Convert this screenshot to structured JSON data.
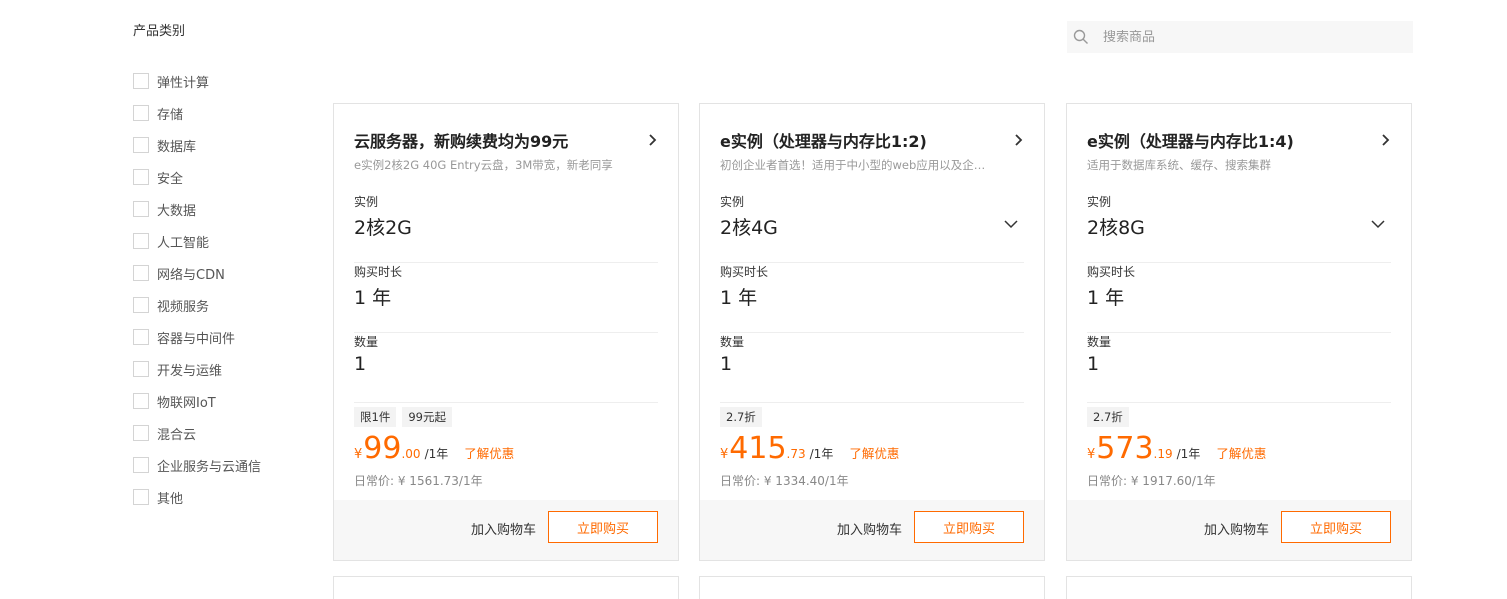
{
  "sidebar": {
    "title": "产品类别",
    "categories": [
      "弹性计算",
      "存储",
      "数据库",
      "安全",
      "大数据",
      "人工智能",
      "网络与CDN",
      "视频服务",
      "容器与中间件",
      "开发与运维",
      "物联网IoT",
      "混合云",
      "企业服务与云通信",
      "其他"
    ]
  },
  "search": {
    "placeholder": "搜索商品",
    "value": ""
  },
  "common": {
    "instance_label": "实例",
    "duration_label": "购买时长",
    "quantity_label": "数量",
    "learn_more": "了解优惠",
    "add_cart": "加入购物车",
    "buy_now": "立即购买",
    "currency": "¥",
    "regular_prefix": "日常价: "
  },
  "cards": [
    {
      "title": "云服务器，新购续费均为99元",
      "desc": "e实例2核2G 40G Entry云盘，3M带宽，新老同享",
      "instance": "2核2G",
      "duration": "1 年",
      "quantity": "1",
      "tags": [
        "限1件",
        "99元起"
      ],
      "price_int": "99",
      "price_dec": ".00",
      "price_unit": "/1年",
      "regular": "¥ 1561.73/1年"
    },
    {
      "title": "e实例（处理器与内存比1:2)",
      "desc": "初创企业者首选！适用于中小型的web应用以及企业…",
      "instance": "2核4G",
      "duration": "1 年",
      "quantity": "1",
      "tags": [
        "2.7折"
      ],
      "price_int": "415",
      "price_dec": ".73",
      "price_unit": "/1年",
      "regular": "¥ 1334.40/1年"
    },
    {
      "title": "e实例（处理器与内存比1:4)",
      "desc": "适用于数据库系统、缓存、搜索集群",
      "instance": "2核8G",
      "duration": "1 年",
      "quantity": "1",
      "tags": [
        "2.7折"
      ],
      "price_int": "573",
      "price_dec": ".19",
      "price_unit": "/1年",
      "regular": "¥ 1917.60/1年"
    }
  ],
  "colors": {
    "accent": "#ff6a00",
    "border": "#e3e3e3",
    "footer_bg": "#f7f7f7"
  }
}
